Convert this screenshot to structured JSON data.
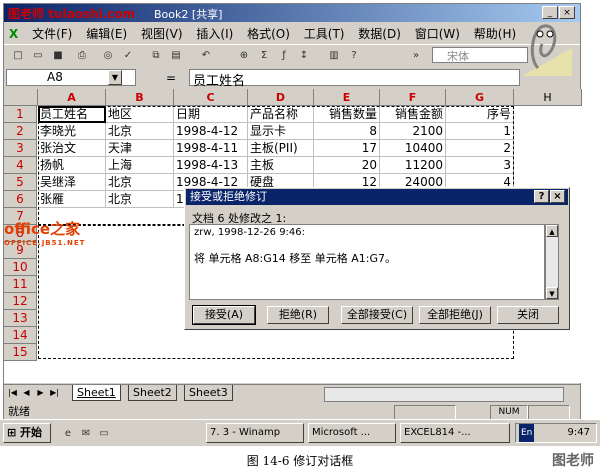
{
  "window": {
    "title": "Book2 [共享]",
    "watermark_top": "图老师 tulaoshi.com"
  },
  "menu": [
    "文件(F)",
    "编辑(E)",
    "视图(V)",
    "插入(I)",
    "格式(O)",
    "工具(T)",
    "数据(D)",
    "窗口(W)",
    "帮助(H)"
  ],
  "toolbar": {
    "font_name": "宋体"
  },
  "formula_bar": {
    "name_box": "A8",
    "equals": "=",
    "content": "员工姓名"
  },
  "sheet": {
    "columns": [
      "A",
      "B",
      "C",
      "D",
      "E",
      "F",
      "G",
      "H"
    ],
    "rows": [
      "1",
      "2",
      "3",
      "4",
      "5",
      "6",
      "7",
      "8",
      "9",
      "10",
      "11",
      "12",
      "13",
      "14",
      "15"
    ],
    "data": [
      [
        "员工姓名",
        "地区",
        "日期",
        "产品名称",
        "销售数量",
        "销售金额",
        "序号"
      ],
      [
        "李晓光",
        "北京",
        "1998-4-12",
        "显示卡",
        "8",
        "2100",
        "1"
      ],
      [
        "张治文",
        "天津",
        "1998-4-11",
        "主板(PII)",
        "17",
        "10400",
        "2"
      ],
      [
        "扬帆",
        "上海",
        "1998-4-13",
        "主板",
        "20",
        "11200",
        "3"
      ],
      [
        "吴继泽",
        "北京",
        "1998-4-12",
        "硬盘",
        "12",
        "24000",
        "4"
      ],
      [
        "张雁",
        "北京",
        "1",
        "",
        "",
        "",
        ""
      ]
    ],
    "tabs": [
      "Sheet1",
      "Sheet2",
      "Sheet3"
    ]
  },
  "status": {
    "text": "就绪",
    "num": "NUM"
  },
  "dialog": {
    "title": "接受或拒绝修订",
    "help": "?",
    "close": "×",
    "header": "文档 6 处修改之 1:",
    "author_line": "zrw, 1998-12-26 9:46:",
    "change_line": "将 单元格 A8:G14 移至 单元格 A1:G7。",
    "buttons": [
      "接受(A)",
      "拒绝(R)",
      "全部接受(C)",
      "全部拒绝(J)",
      "关闭"
    ]
  },
  "taskbar": {
    "start": "开始",
    "tasks": [
      "7. 3 - Winamp",
      "Microsoft ...",
      "EXCEL814 -..."
    ],
    "lang": "En",
    "time": "9:47"
  },
  "watermarks": {
    "office": "office之家",
    "office_url": "OFFICE.JB51.NET",
    "corner": "图老师"
  },
  "caption": "图 14-6    修订对话框"
}
